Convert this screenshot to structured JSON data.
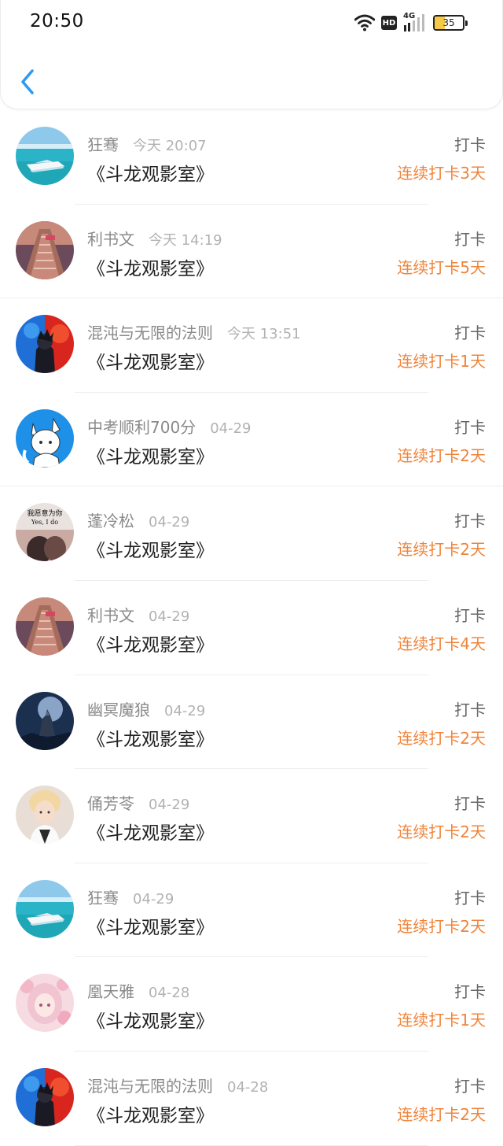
{
  "status_bar": {
    "time": "20:50",
    "network_type": "4G",
    "hd_label": "HD",
    "battery_level": "35"
  },
  "header": {
    "back_icon": "chevron-left-icon"
  },
  "colors": {
    "accent": "#2b9af3",
    "streak": "#f0843a"
  },
  "checkins": [
    {
      "name": "狂骞",
      "time": "今天 20:07",
      "title": "《斗龙观影室》",
      "action": "打卡",
      "streak": "连续打卡3天",
      "avatar": "speedboat-sea"
    },
    {
      "name": "利书文",
      "time": "今天 14:19",
      "title": "《斗龙观影室》",
      "action": "打卡",
      "streak": "连续打卡5天",
      "avatar": "bridge-sunset"
    },
    {
      "name": "混沌与无限的法则",
      "time": "今天 13:51",
      "title": "《斗龙观影室》",
      "action": "打卡",
      "streak": "连续打卡1天",
      "avatar": "red-blue-anime"
    },
    {
      "name": "中考顺利700分",
      "time": "04-29",
      "title": "《斗龙观影室》",
      "action": "打卡",
      "streak": "连续打卡2天",
      "avatar": "white-cat-boy"
    },
    {
      "name": "蓬冷松",
      "time": "04-29",
      "title": "《斗龙观影室》",
      "action": "打卡",
      "streak": "连续打卡2天",
      "avatar": "couple-text",
      "avatar_text_1": "我愿意为你",
      "avatar_text_2": "Yes, I do"
    },
    {
      "name": "利书文",
      "time": "04-29",
      "title": "《斗龙观影室》",
      "action": "打卡",
      "streak": "连续打卡4天",
      "avatar": "bridge-sunset"
    },
    {
      "name": "幽冥魔狼",
      "time": "04-29",
      "title": "《斗龙观影室》",
      "action": "打卡",
      "streak": "连续打卡2天",
      "avatar": "wolf-moon"
    },
    {
      "name": "俑芳苓",
      "time": "04-29",
      "title": "《斗龙观影室》",
      "action": "打卡",
      "streak": "连续打卡2天",
      "avatar": "boy-portrait"
    },
    {
      "name": "狂骞",
      "time": "04-29",
      "title": "《斗龙观影室》",
      "action": "打卡",
      "streak": "连续打卡2天",
      "avatar": "speedboat-sea"
    },
    {
      "name": "凰天雅",
      "time": "04-28",
      "title": "《斗龙观影室》",
      "action": "打卡",
      "streak": "连续打卡1天",
      "avatar": "pink-anime-girl"
    },
    {
      "name": "混沌与无限的法则",
      "time": "04-28",
      "title": "《斗龙观影室》",
      "action": "打卡",
      "streak": "连续打卡2天",
      "avatar": "red-blue-anime"
    }
  ]
}
